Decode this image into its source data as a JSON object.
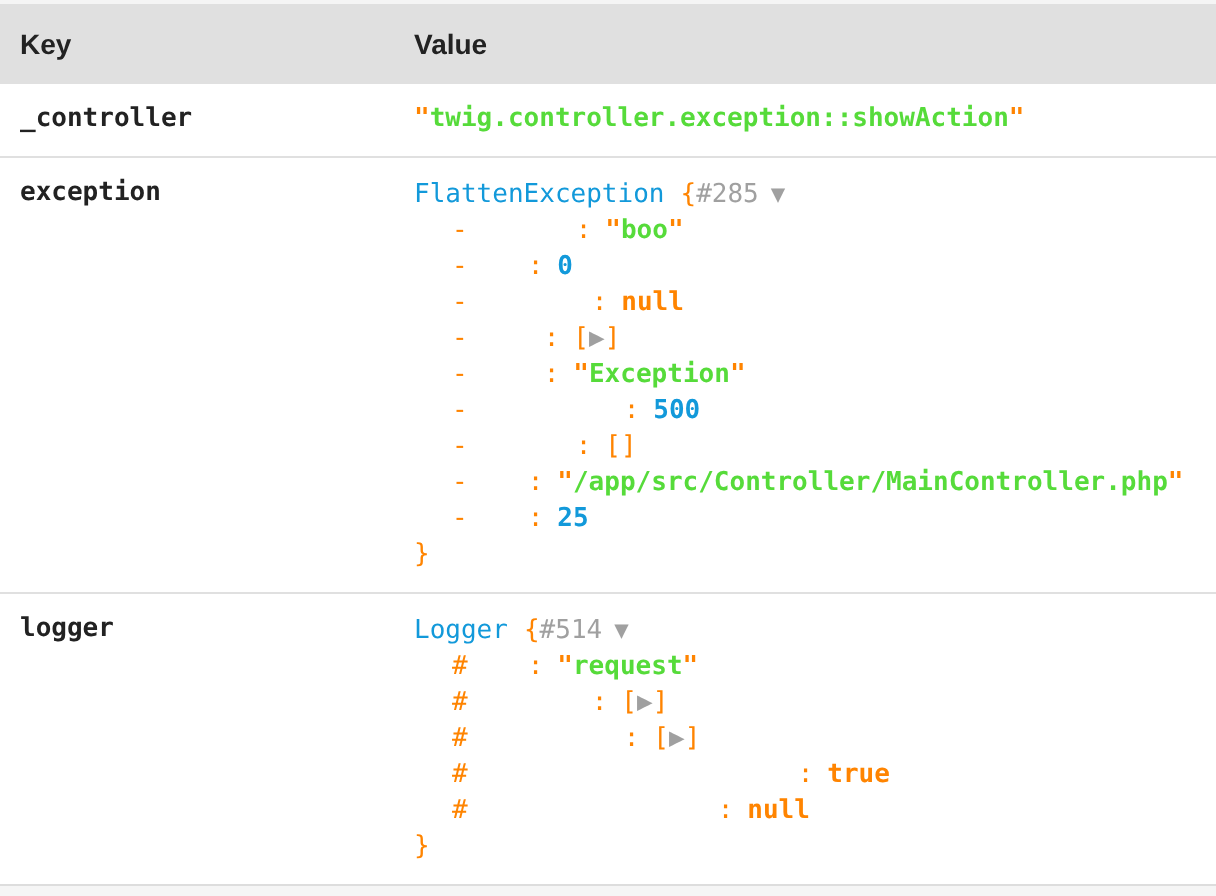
{
  "table": {
    "columns": [
      "Key",
      "Value"
    ],
    "rows": [
      {
        "key": "_controller",
        "value": {
          "kind": "string",
          "text": "\"twig.controller.exception::showAction\""
        }
      },
      {
        "key": "exception",
        "value": {
          "kind": "object",
          "class": "FlattenException",
          "open": "{",
          "id": "#285",
          "toggle": "▼",
          "close": "}",
          "properties": [
            {
              "marker": "-",
              "sep": ":",
              "kind": "string",
              "text": "\"boo\""
            },
            {
              "marker": "-",
              "sep": ":",
              "kind": "number",
              "text": "0"
            },
            {
              "marker": "-",
              "sep": ":",
              "kind": "const",
              "text": "null"
            },
            {
              "marker": "-",
              "sep": ":",
              "kind": "array",
              "text": "[▶]"
            },
            {
              "marker": "-",
              "sep": ":",
              "kind": "string",
              "text": "\"Exception\""
            },
            {
              "marker": "-",
              "sep": ":",
              "kind": "number",
              "text": "500"
            },
            {
              "marker": "-",
              "sep": ":",
              "kind": "array",
              "text": "[]"
            },
            {
              "marker": "-",
              "sep": ":",
              "kind": "string",
              "text": "\"/app/src/Controller/MainController.php\""
            },
            {
              "marker": "-",
              "sep": ":",
              "kind": "number",
              "text": "25"
            }
          ]
        }
      },
      {
        "key": "logger",
        "value": {
          "kind": "object",
          "class": "Logger",
          "open": "{",
          "id": "#514",
          "toggle": "▼",
          "close": "}",
          "properties": [
            {
              "marker": "#",
              "sep": ":",
              "kind": "string",
              "text": "\"request\""
            },
            {
              "marker": "#",
              "sep": ":",
              "kind": "array",
              "text": "[▶]"
            },
            {
              "marker": "#",
              "sep": ":",
              "kind": "array",
              "text": "[▶]"
            },
            {
              "marker": "#",
              "sep": ":",
              "kind": "const",
              "text": "true"
            },
            {
              "marker": "#",
              "sep": ":",
              "kind": "const",
              "text": "null"
            }
          ]
        }
      }
    ]
  }
}
